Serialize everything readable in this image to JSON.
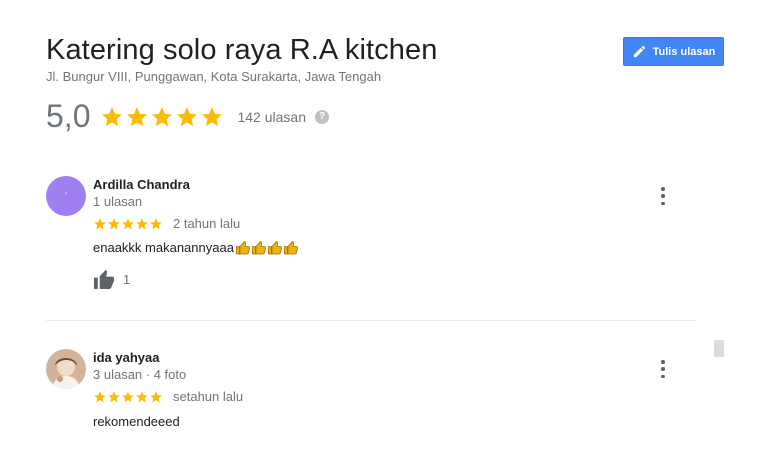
{
  "place": {
    "title": "Katering solo raya R.A kitchen",
    "address": "Jl. Bungur VIII, Punggawan, Kota Surakarta, Jawa Tengah",
    "rating": "5,0",
    "rating_stars": 5,
    "review_count": "142 ulasan",
    "help_icon": "?"
  },
  "actions": {
    "write_review_label": "Tulis ulasan",
    "write_review_icon": "pencil-icon"
  },
  "reviews": [
    {
      "name": "Ardilla Chandra",
      "meta": "1 ulasan",
      "stars": 5,
      "time": "2 tahun lalu",
      "text": "enaakkk makanannyaaa",
      "emoji": "thumbs-up-icon x4",
      "likes": "1",
      "avatar_color": "#a07ff0"
    },
    {
      "name": "ida yahyaa",
      "meta": "3 ulasan · 4 foto",
      "stars": 5,
      "time": "setahun lalu",
      "text": "rekomendeeed",
      "avatar_color": "#c9a58a"
    }
  ],
  "colors": {
    "accent": "#4285f4",
    "star": "#fbbc04",
    "muted": "#70757a"
  }
}
